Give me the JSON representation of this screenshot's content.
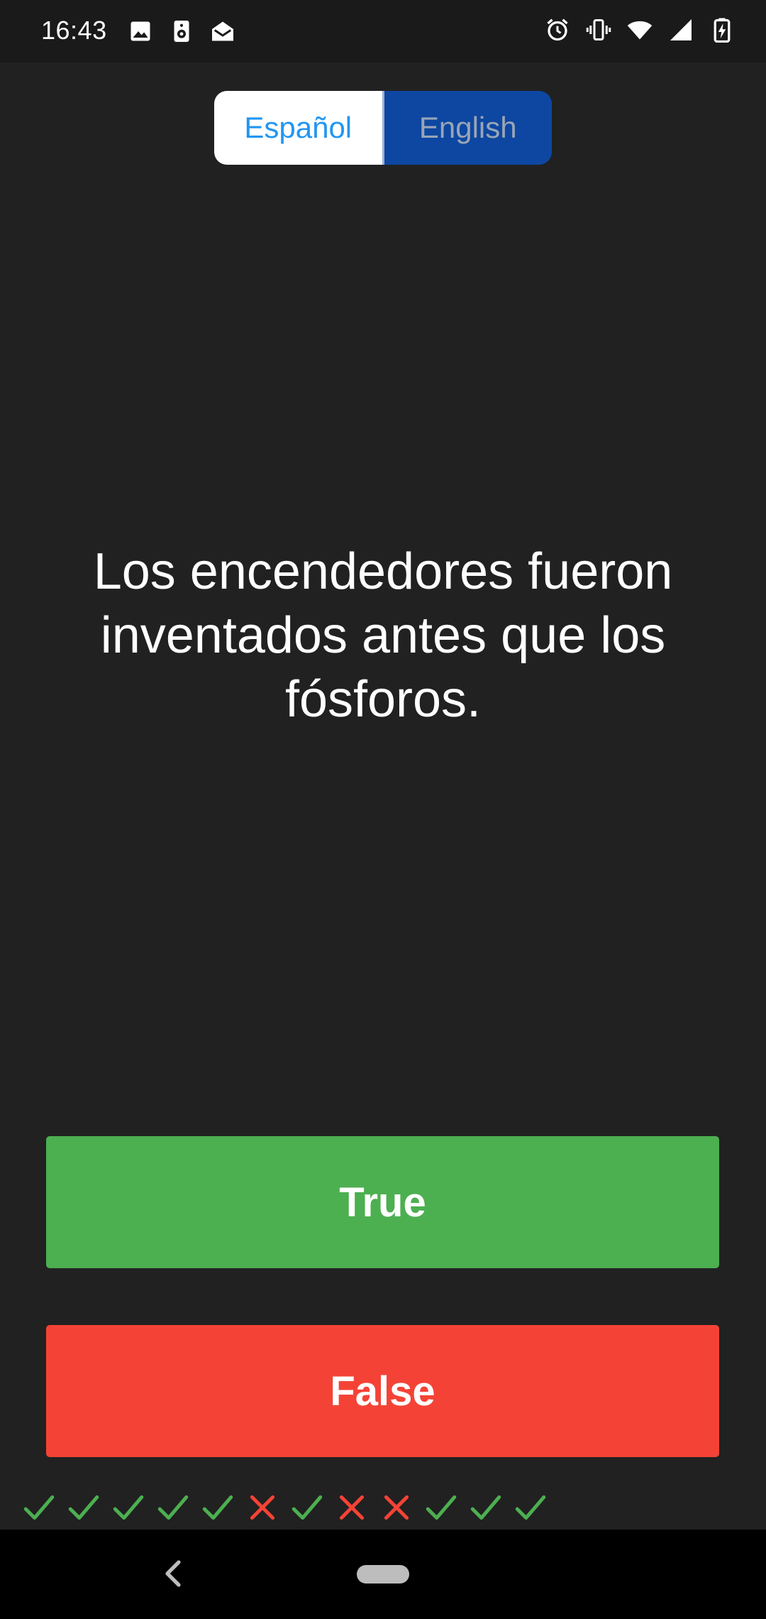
{
  "status_bar": {
    "time": "16:43",
    "left_icons": [
      "image-icon",
      "speaker-icon",
      "mail-open-icon"
    ],
    "right_icons": [
      "alarm-icon",
      "vibrate-icon",
      "wifi-icon",
      "cell-signal-icon",
      "battery-charging-icon"
    ]
  },
  "language_toggle": {
    "options": [
      {
        "label": "Español",
        "selected": false
      },
      {
        "label": "English",
        "selected": true
      }
    ]
  },
  "question": {
    "text": "Los encendedores fueron inventados antes que los fósforos."
  },
  "answers": {
    "true_label": "True",
    "false_label": "False"
  },
  "history": {
    "results": [
      "correct",
      "correct",
      "correct",
      "correct",
      "correct",
      "wrong",
      "correct",
      "wrong",
      "wrong",
      "correct",
      "correct",
      "correct"
    ]
  },
  "colors": {
    "background": "#212121",
    "true_button": "#4caf50",
    "false_button": "#f44336",
    "toggle_selected": "#0d47a1",
    "toggle_unselected_text": "#2196f3",
    "correct_mark": "#4caf50",
    "wrong_mark": "#f44336"
  },
  "navigation": {
    "icons": [
      "back-icon",
      "home-pill-icon"
    ]
  }
}
